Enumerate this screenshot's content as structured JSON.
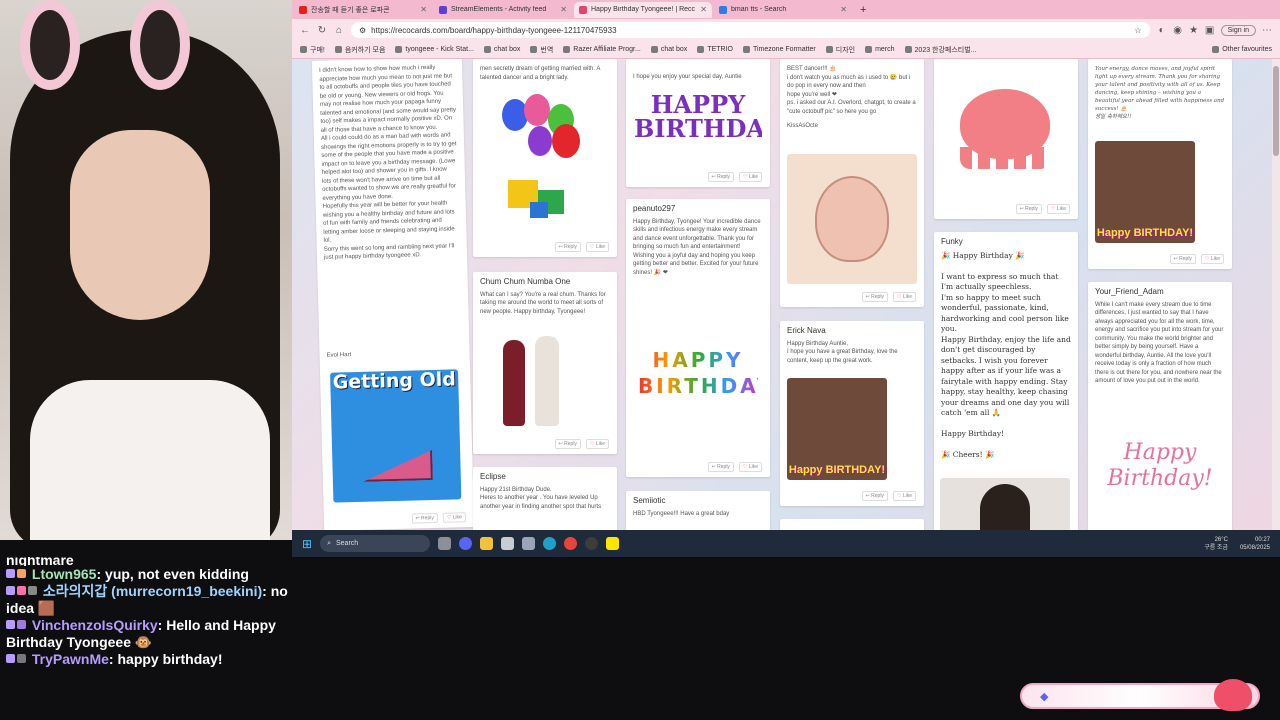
{
  "browser": {
    "tabs": [
      {
        "label": "잔송할 때 듣기 좋은 로파콘",
        "active": false,
        "icon_color": "#e62117"
      },
      {
        "label": "StreamElements - Activity feed",
        "active": false,
        "icon_color": "#5b3fd6"
      },
      {
        "label": "Happy Birthday Tyongeee! | Recc",
        "active": true,
        "icon_color": "#e5446d"
      },
      {
        "label": "bman tts - Search",
        "active": false,
        "icon_color": "#2b7de9"
      }
    ],
    "new_tab": "+",
    "url": "https://recocards.com/board/happy-birthday-tyongeee-121170475933",
    "sign_in": "Sign in",
    "bookmarks": [
      "구매!",
      "음커하기 모음",
      "tyongeee - Kick Stat...",
      "chat box",
      "번역",
      "Razer Affiliate Progr...",
      "chat box",
      "TETRIO",
      "Timezone Formatter",
      "디자인",
      "merch",
      "2023 한강페스티벌..."
    ],
    "other_favourites": "Other favourites"
  },
  "cards": {
    "c1": {
      "text": "I didn't know how to show how much i really appreciate how much you mean to not just me but to all octobuffs and people tiles you have touched be old or young. New viewers or old frogs. You may not realise how much your papaga funny talented and emotional (and some would say pretty too) self makes a impact normally positive xD. On all of those that have a chance to know you.\nAll i could could do as a man bad with words and showings the right emotions properly is to try to get some of the people that you have made a positive impact on to leave you a birthday message. (Lowe helped alot too) and shower you in gifts. I know lots of these won't have arrive on time but all octobuffs wanted to show we are really greatful for everything you have done.\nHopefully this year will be better for your health wishing you a healthy birthday and future and lots of fun with family and friends celebrating and letting amber loose or sleeping and staying inside lol.\nSorry this went so long and rambling next year I'll just put happy birthday tyongeee xD.",
      "sign": "Evol Hart",
      "reply": "Reply",
      "like": "Like",
      "gif_text": "Getting Old"
    },
    "c2": {
      "text": "men secretly dream of getting married with. A talented dancer and a bright lady.",
      "reply": "Reply",
      "like": "Like"
    },
    "c3": {
      "author": "Chum Chum Numba One",
      "text": "What can I say? You're a real chum. Thanks for taking me around the world to meet all sorts of new people. Happy birthday, Tyongeee!",
      "reply": "Reply",
      "like": "Like"
    },
    "c4": {
      "author": "Eclipse",
      "text": "Happy 21st Birthday Dude.\nHeres to another year . You have leveled Up another year in finding another spot that hurts"
    },
    "c5": {
      "text": "I hope you enjoy your special day, Auntie",
      "gif_text": "HAPPY BIRTHDAY",
      "reply": "Reply",
      "like": "Like"
    },
    "c6": {
      "author": "peanuto297",
      "text": "Happy Birthday, Tyongee! Your incredible dance skills and infectious energy make every stream and dance event unforgettable. Thank you for bringing so much fun and entertainment! Wishing you a joyful day and hoping you keep getting better and better. Excited for your future shines! 🎉 ❤",
      "gif_text": "HAPPY BIRTHDAY",
      "reply": "Reply",
      "like": "Like"
    },
    "c7": {
      "author": "Semiiotic",
      "text": "HBD Tyongeee!!! Have a great bday"
    },
    "c8": {
      "text": "BEST dancer!!! 🎂\ni don't watch you as much as i used to 😢 but i do pop in every now and then\nhope you're well ❤\nps. i asked our A.I. Overlord, chatgpt, to create a \"cute octobuff pic\" so here you go",
      "sign": "KissAsOcte",
      "reply": "Reply",
      "like": "Like"
    },
    "c9": {
      "author": "Erick Nava",
      "text": "Happy Birthday Auntie,\nI hope you have a great Birthday, love the content, keep up the great work.",
      "gif_text": "Happy BIRTHDAY!",
      "reply": "Reply",
      "like": "Like"
    },
    "c10": {
      "reply": "Reply",
      "like": "Like"
    },
    "c11": {
      "author": "Funky",
      "text": "🎉 Happy Birthday 🎉\n\nI want to express so much that I'm actually speechless.\nI'm so happy to meet such wonderful, passionate, kind, hardworking and cool person like you.\nHappy Birthday, enjoy the life and don't get discouraged by setbacks. I wish you forever happy after as if your life was a fairytale with happy ending. Stay happy, stay healthy, keep chasing your dreams and one day you will catch 'em all 🙏\n\nHappy Birthday!\n\n🎉 Cheers! 🎉"
    },
    "c12": {
      "text": "Your energy, dance moves, and joyful spirit light up every stream. Thank you for sharing your talent and positivity with all of us. Keep dancing, keep shining – wishing you a beautiful year ahead filled with happiness and success! 🎂\n생일 축하해요!!",
      "gif_text": "Happy BIRTHDAY!",
      "reply": "Reply",
      "like": "Like"
    },
    "c13": {
      "author": "Your_Friend_Adam",
      "text": "While I can't make every stream due to time differences, I just wanted to say that I have always appreciated you for all the work, time, energy and sacrifice you put into stream for your community. You make the world brighter and better simply by being yourself. Have a wonderful birthday, Auntie. All the love you'll receive today is only a fraction of how much there is out there for you, and nowhere near the amount of love you put out in the world.",
      "script_text": "Happy Birthday!"
    }
  },
  "taskbar": {
    "search": "Search",
    "weather_temp": "26°C",
    "weather_desc": "구름 조금",
    "time": "00:27",
    "date": "05/08/2025"
  },
  "chat": [
    {
      "user": "Ltown965",
      "color": "#a6e3b4",
      "message": "yup, not even kidding"
    },
    {
      "user": "소라의지갑 (murrecorn19_beekini)",
      "color": "#9fd4ff",
      "message": "no idea 🟫"
    },
    {
      "user": "VinchenzoIsQuirky",
      "color": "#b69cff",
      "message": "Hello and Happy Birthday Tyongeee 🐵"
    },
    {
      "user": "TryPawnMe",
      "color": "#b69cff",
      "message": "happy birthday!"
    }
  ],
  "chat_top_partial": "nightmare"
}
